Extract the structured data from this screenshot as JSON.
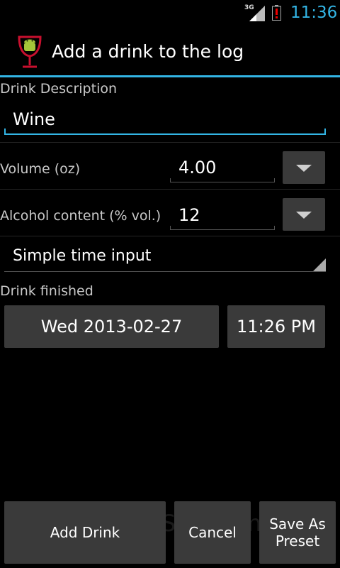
{
  "status_bar": {
    "network": "3G",
    "time": "11:36"
  },
  "action_bar": {
    "title": "Add a drink to the log"
  },
  "form": {
    "description_label": "Drink Description",
    "description_value": "Wine",
    "volume_label": "Volume (oz)",
    "volume_value": "4.00",
    "alcohol_label": "Alcohol content (% vol.)",
    "alcohol_value": "12",
    "time_input_mode": "Simple time input",
    "finished_label": "Drink finished",
    "date_value": "Wed 2013-02-27",
    "time_value": "11:26 PM"
  },
  "buttons": {
    "add_drink": "Add Drink",
    "cancel": "Cancel",
    "save_preset_line1": "Save As",
    "save_preset_line2": "Preset"
  },
  "watermark": "UpdateStar.com",
  "colors": {
    "accent": "#33b5e5",
    "background": "#000000",
    "button": "#3a3a3a"
  }
}
